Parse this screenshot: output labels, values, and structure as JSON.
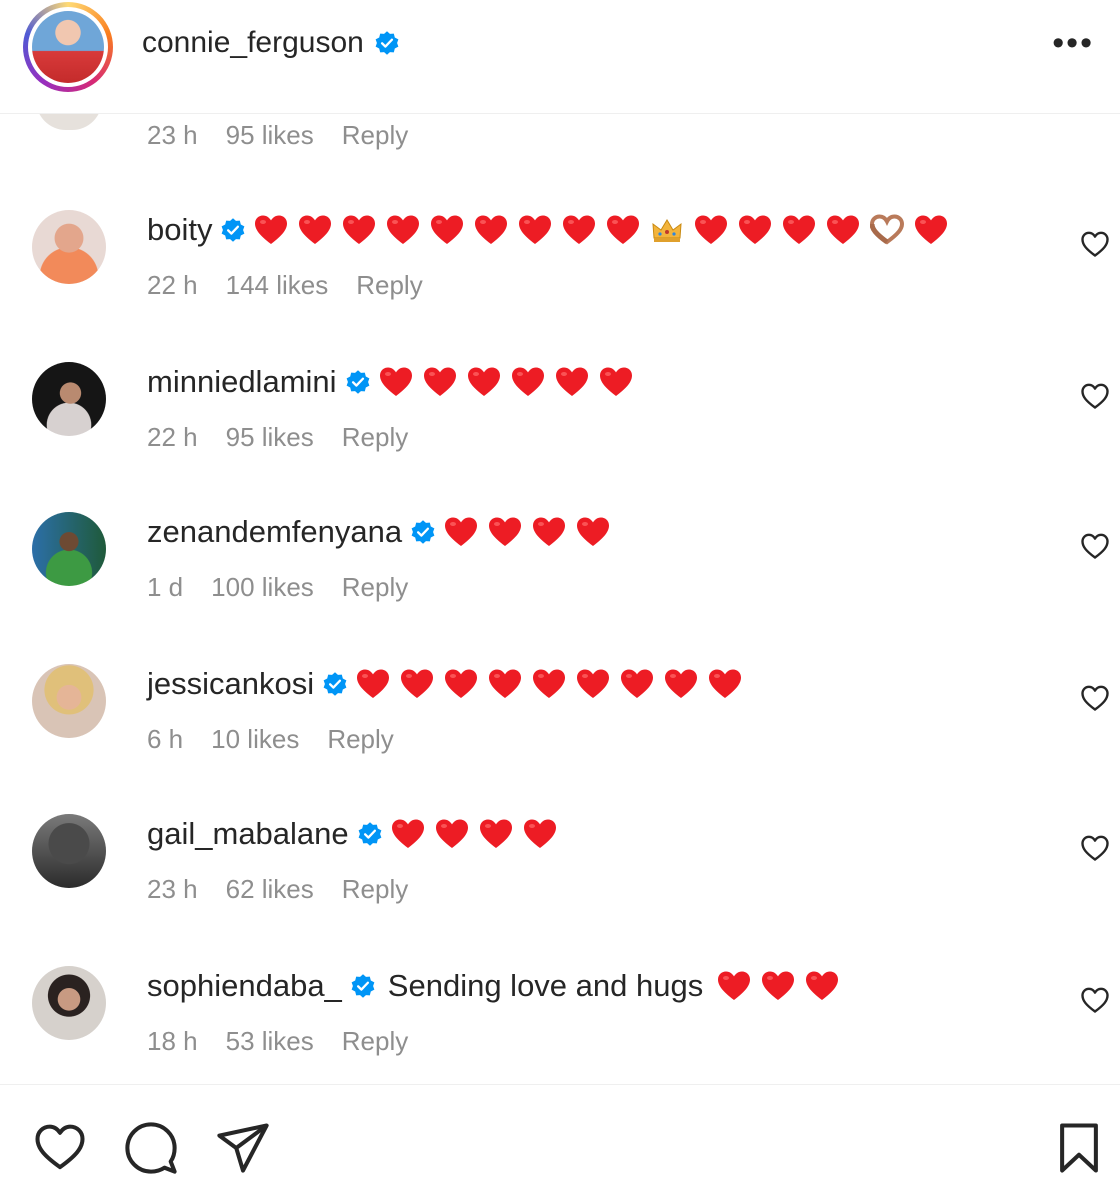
{
  "header": {
    "username": "connie_ferguson",
    "verified": true,
    "more_icon": "more-horizontal-icon"
  },
  "partial_comment": {
    "time": "23 h",
    "likes": "95 likes",
    "reply": "Reply"
  },
  "comments": [
    {
      "username": "boity",
      "verified": true,
      "text": "",
      "emojis": [
        "heart",
        "heart",
        "heart",
        "heart",
        "heart",
        "heart",
        "heart",
        "heart",
        "heart",
        "crown",
        "heart",
        "heart",
        "heart",
        "heart",
        "heart-hands",
        "heart"
      ],
      "time": "22 h",
      "likes": "144 likes",
      "reply": "Reply"
    },
    {
      "username": "minniedlamini",
      "verified": true,
      "text": "",
      "emojis": [
        "heart",
        "heart",
        "heart",
        "heart",
        "heart",
        "heart"
      ],
      "time": "22 h",
      "likes": "95 likes",
      "reply": "Reply"
    },
    {
      "username": "zenandemfenyana",
      "verified": true,
      "text": "",
      "emojis": [
        "heart",
        "heart",
        "heart",
        "heart"
      ],
      "time": "1 d",
      "likes": "100 likes",
      "reply": "Reply"
    },
    {
      "username": "jessicankosi",
      "verified": true,
      "text": "",
      "emojis": [
        "heart",
        "heart",
        "heart",
        "heart",
        "heart",
        "heart",
        "heart",
        "heart",
        "heart"
      ],
      "time": "6 h",
      "likes": "10 likes",
      "reply": "Reply"
    },
    {
      "username": "gail_mabalane",
      "verified": true,
      "text": "",
      "emojis": [
        "heart",
        "heart",
        "heart",
        "heart"
      ],
      "time": "23 h",
      "likes": "62 likes",
      "reply": "Reply"
    },
    {
      "username": "sophiendaba_",
      "verified": true,
      "text": "Sending love and hugs",
      "emojis": [
        "heart",
        "heart",
        "heart"
      ],
      "time": "18 h",
      "likes": "53 likes",
      "reply": "Reply"
    }
  ],
  "colors": {
    "verified_blue": "#0095f6",
    "heart_red": "#ed1c24",
    "meta_gray": "#8e8e8e",
    "text": "#262626"
  },
  "footer": {
    "icons": [
      "like-icon",
      "comment-icon",
      "share-icon",
      "save-icon"
    ]
  }
}
